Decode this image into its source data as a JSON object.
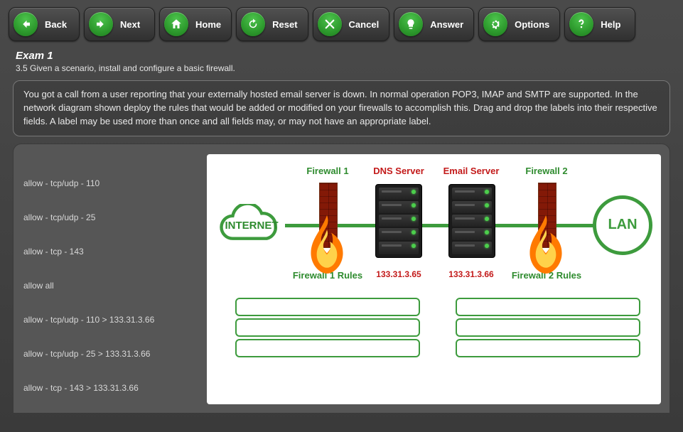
{
  "toolbar": {
    "back": "Back",
    "next": "Next",
    "home": "Home",
    "reset": "Reset",
    "cancel": "Cancel",
    "answer": "Answer",
    "options": "Options",
    "help": "Help"
  },
  "header": {
    "title": "Exam 1",
    "subtitle": "3.5 Given a scenario, install and configure a basic firewall."
  },
  "scenario": "You got a call from a user reporting that your externally hosted email server is down. In normal operation POP3, IMAP and SMTP are supported. In the network diagram shown deploy the rules that would be added or modified on your firewalls to accomplish this. Drag and drop the labels into their respective fields. A label may be used more than once and all fields may, or may not have an appropriate label.",
  "labels": [
    "allow - tcp/udp - 110",
    "allow - tcp/udp - 25",
    "allow - tcp - 143",
    "allow all",
    "allow - tcp/udp - 110 > 133.31.3.66",
    "allow - tcp/udp - 25 > 133.31.3.66",
    "allow - tcp - 143 > 133.31.3.66"
  ],
  "diagram": {
    "internet": "INTERNET",
    "lan": "LAN",
    "fw1_title": "Firewall 1",
    "fw2_title": "Firewall 2",
    "dns_title": "DNS Server",
    "email_title": "Email Server",
    "dns_ip": "133.31.3.65",
    "email_ip": "133.31.3.66",
    "fw1_rules": "Firewall 1 Rules",
    "fw2_rules": "Firewall 2 Rules"
  }
}
